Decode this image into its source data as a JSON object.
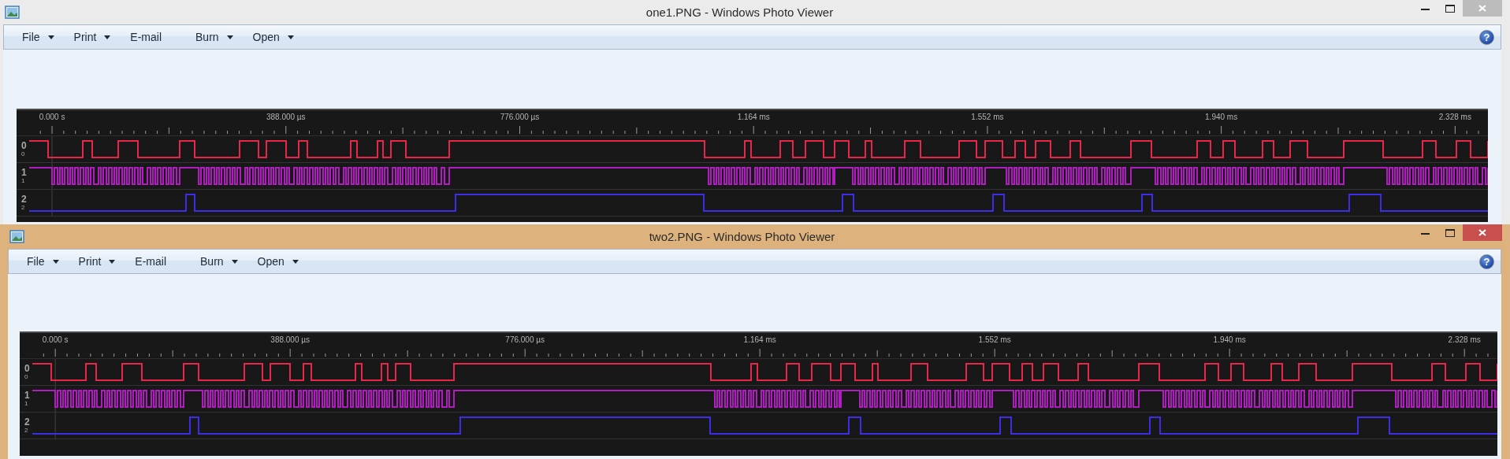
{
  "windows": [
    {
      "title": "one1.PNG - Windows Photo Viewer",
      "active": false,
      "menu": [
        {
          "label": "File",
          "dropdown": true
        },
        {
          "label": "Print",
          "dropdown": true
        },
        {
          "label": "E-mail",
          "dropdown": false
        },
        {
          "label": "Burn",
          "dropdown": true
        },
        {
          "label": "Open",
          "dropdown": true
        }
      ],
      "help": "?",
      "capture": {
        "time_labels": [
          "0.000 s",
          "388.000 µs",
          "776.000 µs",
          "1.164 ms",
          "1.552 ms",
          "1.940 ms",
          "2.328 ms"
        ],
        "channels": [
          {
            "name": "0",
            "index_label": "0",
            "color": "#e8264a"
          },
          {
            "name": "1",
            "index_label": "1",
            "color": "#b01cc0"
          },
          {
            "name": "2",
            "index_label": "2",
            "color": "#3b2ee6"
          }
        ]
      }
    },
    {
      "title": "two2.PNG - Windows Photo Viewer",
      "active": true,
      "menu": [
        {
          "label": "File",
          "dropdown": true
        },
        {
          "label": "Print",
          "dropdown": true
        },
        {
          "label": "E-mail",
          "dropdown": false
        },
        {
          "label": "Burn",
          "dropdown": true
        },
        {
          "label": "Open",
          "dropdown": true
        }
      ],
      "help": "?",
      "capture": {
        "time_labels": [
          "0.000 s",
          "388.000 µs",
          "776.000 µs",
          "1.164 ms",
          "1.552 ms",
          "1.940 ms",
          "2.328 ms"
        ],
        "channels": [
          {
            "name": "0",
            "index_label": "0",
            "color": "#e8264a"
          },
          {
            "name": "1",
            "index_label": "1",
            "color": "#b01cc0"
          },
          {
            "name": "2",
            "index_label": "2",
            "color": "#3b2ee6"
          }
        ]
      }
    }
  ]
}
